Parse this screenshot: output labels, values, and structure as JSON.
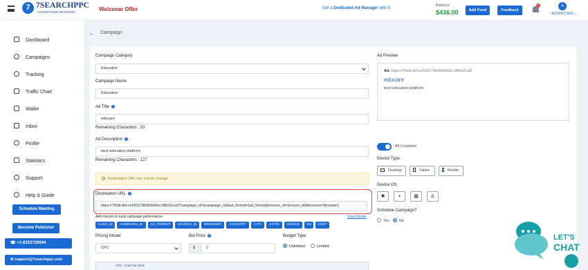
{
  "header": {
    "logo_text": "7SEARCHPPC",
    "logo_sub": "ADVERTISING NETWORK",
    "logo_mark": "7",
    "welcome": "Welcome Offer",
    "banner_prefix": "Get a ",
    "banner_bold": "Dedicated Ad Manager",
    "banner_suffix": " with 5",
    "balance_label": "Balance",
    "balance_value": "$436.00",
    "add_fund": "Add Fund",
    "feedback": "Feedback",
    "notif_count": "1",
    "avatar_letter": "A",
    "role": "ADVERTISER ⌄"
  },
  "sidebar": {
    "items": [
      {
        "label": "Dashboard",
        "icon": "dashboard-icon"
      },
      {
        "label": "Campaigns",
        "icon": "campaigns-icon"
      },
      {
        "label": "Tracking",
        "icon": "tracking-icon"
      },
      {
        "label": "Traffic Chart",
        "icon": "chart-icon"
      },
      {
        "label": "Wallet",
        "icon": "wallet-icon"
      },
      {
        "label": "Inbox",
        "icon": "inbox-icon"
      },
      {
        "label": "Profile",
        "icon": "profile-icon"
      },
      {
        "label": "Statistics",
        "icon": "statistics-icon"
      },
      {
        "label": "Support",
        "icon": "support-icon"
      },
      {
        "label": "Help & Guide",
        "icon": "help-icon"
      }
    ],
    "schedule_meeting": "Schedule Meeting",
    "become_publisher": "Become Publisher",
    "phone": "+1-8333729044",
    "email": "support@7searchppc.com"
  },
  "page": {
    "title": "Campaign",
    "back_arrow": "←"
  },
  "form": {
    "category_label": "Campaign Category",
    "category_value": "Education",
    "name_label": "Campaign Name",
    "name_value": "Education",
    "ad_title_label": "Ad Title",
    "ad_title_value": "educare",
    "ad_title_remaining": "Remaining Characters : 53",
    "ad_desc_label": "Ad Description",
    "ad_desc_value": "best education platform",
    "ad_desc_remaining": "Remaining Characters : 127",
    "url_note": "Destination URL can not be change.",
    "url_label": "Destination URL",
    "url_value": "https://7lhhb.ttrk.io/691178b3b50d3cc3f8c62ca0?campaign_id={campaign_id}&ad_format={ad_format}&source_id={source_id}&browser={browser}",
    "macros_label": "Add macros to track campaign performance",
    "view_details": "View Details",
    "macros": [
      "CLICK_ID",
      "CAMPAIGN_ID",
      "AD_FORMAT",
      "SOURCE_ID",
      "BROWSER",
      "COUNTRY",
      "CITY",
      "STATE",
      "DEVICE",
      "OS",
      "COST"
    ],
    "pricing_label": "Pricing Model",
    "pricing_value": "CPC",
    "bid_label": "Bid Price",
    "bid_prefix": "$",
    "bid_value": "2",
    "budget_label": "Budget Type",
    "budget_unlimited": "Unlimited",
    "budget_limited": "Limited",
    "cpc_note": "CPC : Cost Per Click"
  },
  "preview": {
    "label": "Ad Preview",
    "ad_tag": "Ad.",
    "url": "https://7lhhb.ttrk.io/691178b3b50d3cc3f8c62ca0",
    "title": "educare",
    "desc": "best education platform"
  },
  "targeting": {
    "all_countries": "All Countries",
    "device_type_label": "Device Type",
    "devices": [
      "Desktop",
      "Tablet",
      "Mobile"
    ],
    "device_os_label": "Device OS",
    "os_icons": [
      "android-icon",
      "apple-icon",
      "windows-icon",
      "linux-icon"
    ],
    "os_glyphs": [
      "✱",
      "●",
      "▦",
      "Δ"
    ],
    "schedule_label": "Schedule Campaign?",
    "schedule_yes": "Yes",
    "schedule_no": "No"
  },
  "chat": {
    "line1": "LET'S",
    "line2": "CHAT"
  },
  "colors": {
    "primary": "#1b69d3",
    "accent_red": "#c81e1e",
    "balance_green": "#1e9b3c",
    "chat_teal": "#17a0a8"
  }
}
